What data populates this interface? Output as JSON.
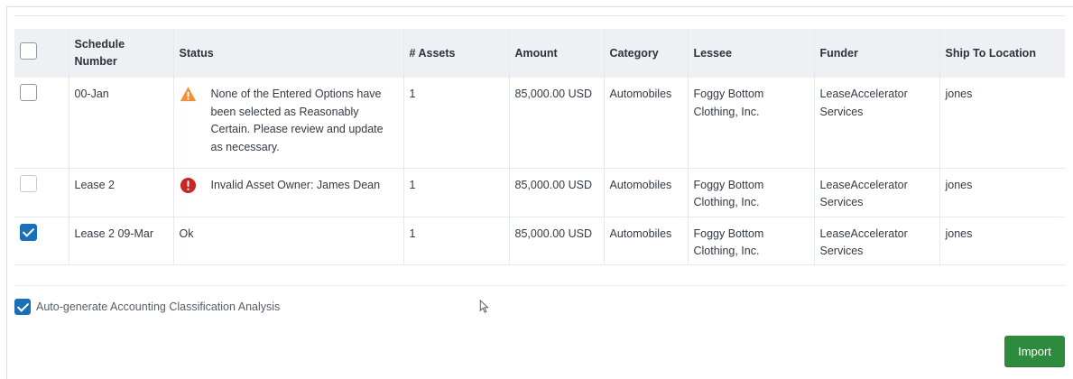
{
  "table": {
    "columns": [
      "Schedule Number",
      "Status",
      "# Assets",
      "Amount",
      "Category",
      "Lessee",
      "Funder",
      "Ship To Location"
    ],
    "rows": [
      {
        "checked": false,
        "schedule": "00-Jan",
        "status_icon": "warning-icon",
        "status": "None of the Entered Options have been selected as Reasonably Certain. Please review and update as necessary.",
        "assets": "1",
        "amount": "85,000.00 USD",
        "category": "Automobiles",
        "lessee": "Foggy Bottom Clothing, Inc.",
        "funder": "LeaseAccelerator Services",
        "ship_to": "jones"
      },
      {
        "checked": false,
        "schedule": "Lease 2",
        "status_icon": "error-icon",
        "status": "Invalid Asset Owner: James Dean",
        "assets": "1",
        "amount": "85,000.00 USD",
        "category": "Automobiles",
        "lessee": "Foggy Bottom Clothing, Inc.",
        "funder": "LeaseAccelerator Services",
        "ship_to": "jones"
      },
      {
        "checked": true,
        "schedule": "Lease 2 09-Mar",
        "status_icon": "",
        "status": "Ok",
        "assets": "1",
        "amount": "85,000.00 USD",
        "category": "Automobiles",
        "lessee": "Foggy Bottom Clothing, Inc.",
        "funder": "LeaseAccelerator Services",
        "ship_to": "jones"
      }
    ]
  },
  "options": {
    "auto_generate_label": "Auto-generate Accounting Classification Analysis",
    "auto_generate_checked": true
  },
  "actions": {
    "import_label": "Import"
  },
  "colors": {
    "accent_blue": "#1a6fb8",
    "warning_orange": "#f0913a",
    "error_red": "#c62828",
    "import_green": "#2e8b3e",
    "header_bg": "#eef0f3"
  }
}
